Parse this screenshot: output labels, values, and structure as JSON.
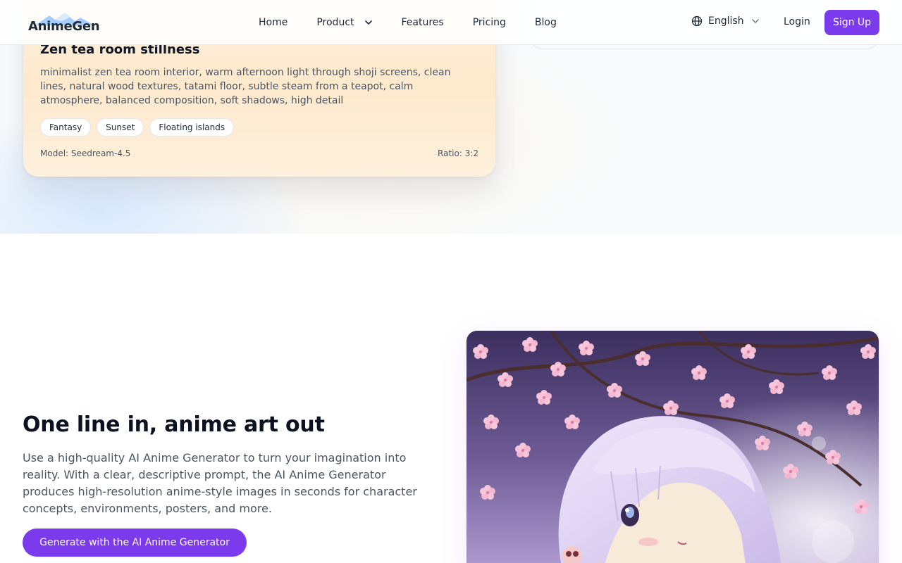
{
  "nav": {
    "brand": "AnimeGen",
    "links": [
      {
        "label": "Home"
      },
      {
        "label": "Product"
      },
      {
        "label": "Features"
      },
      {
        "label": "Pricing"
      },
      {
        "label": "Blog"
      }
    ],
    "language": "English",
    "login": "Login",
    "signup": "Sign Up"
  },
  "example_card": {
    "title": "Zen tea room stillness",
    "prompt": "minimalist zen tea room interior, warm afternoon light through shoji screens, clean lines, natural wood textures, tatami floor, subtle steam from a teapot, calm atmosphere, balanced composition, soft shadows, high detail",
    "tags": [
      "Fantasy",
      "Sunset",
      "Floating islands"
    ],
    "model": "Model: Seedream-4.5",
    "ratio": "Ratio: 3:2"
  },
  "feature": {
    "heading": "One line in, anime art out",
    "body": "Use a high-quality AI Anime Generator to turn your imagination into reality. With a clear, descriptive prompt, the AI Anime Generator produces high-resolution anime-style images in seconds for character concepts, environments, posters, and more.",
    "cta": "Generate with the AI Anime Generator"
  },
  "icons": [
    "logo-mark",
    "chevron-down-icon",
    "globe-icon"
  ],
  "colors": {
    "accent": "#7c3aed",
    "text": "#111827",
    "muted": "#4b5563"
  }
}
